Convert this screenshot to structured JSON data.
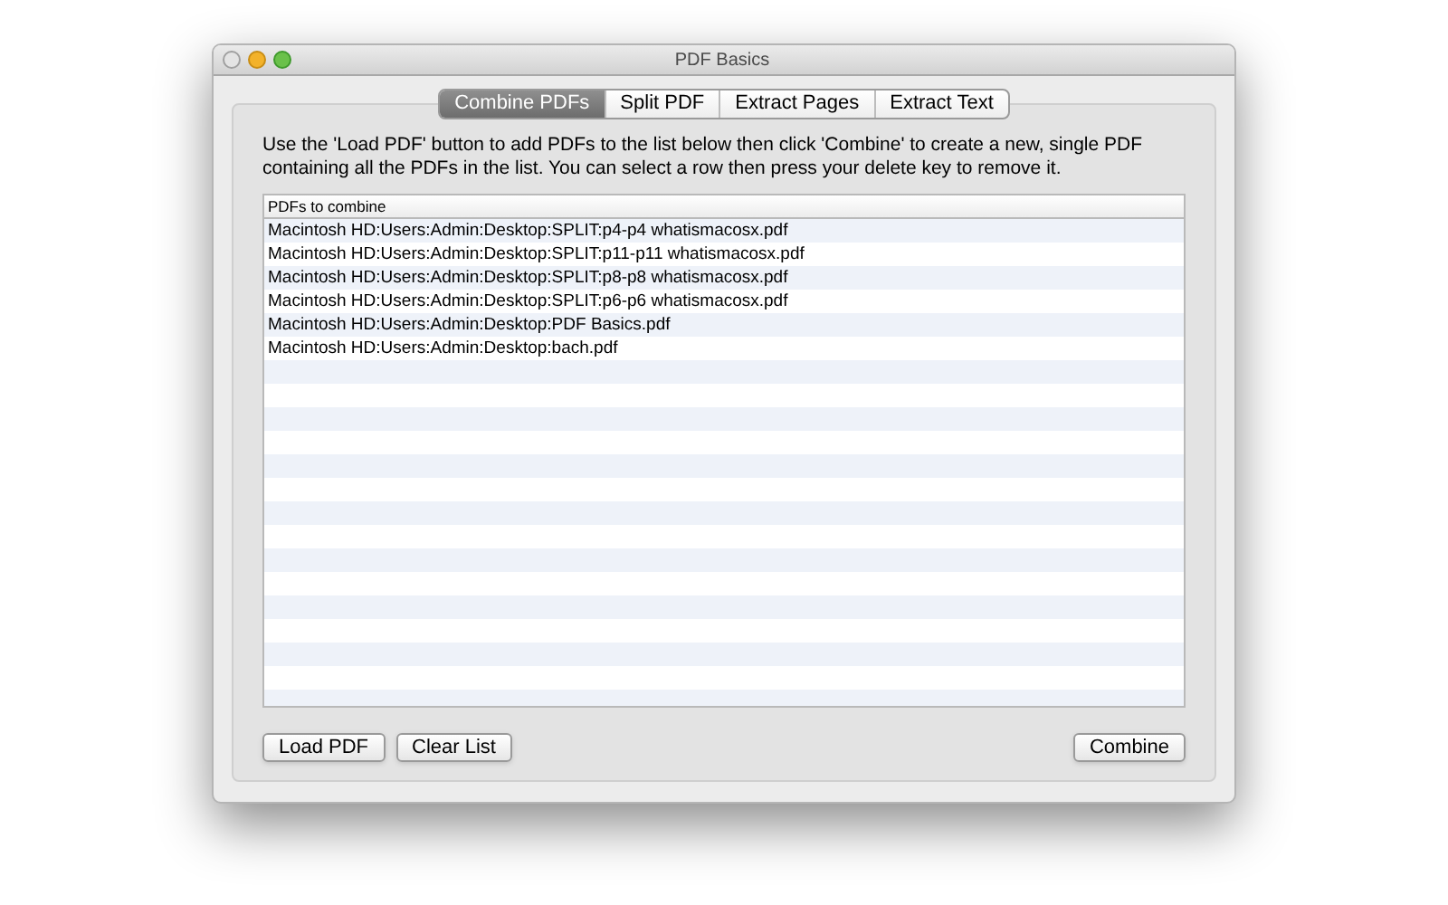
{
  "window": {
    "title": "PDF Basics"
  },
  "tabs": [
    {
      "label": "Combine PDFs",
      "selected": true
    },
    {
      "label": "Split PDF",
      "selected": false
    },
    {
      "label": "Extract Pages",
      "selected": false
    },
    {
      "label": "Extract Text",
      "selected": false
    }
  ],
  "instructions": "Use the 'Load PDF' button to add PDFs to the list below then click 'Combine' to create a new, single PDF containing all the PDFs in the list. You can select a row then press your delete key to remove it.",
  "table": {
    "columns": [
      "PDFs to combine"
    ],
    "rows": [
      "Macintosh HD:Users:Admin:Desktop:SPLIT:p4-p4 whatismacosx.pdf",
      "Macintosh HD:Users:Admin:Desktop:SPLIT:p11-p11 whatismacosx.pdf",
      "Macintosh HD:Users:Admin:Desktop:SPLIT:p8-p8 whatismacosx.pdf",
      "Macintosh HD:Users:Admin:Desktop:SPLIT:p6-p6 whatismacosx.pdf",
      "Macintosh HD:Users:Admin:Desktop:PDF Basics.pdf",
      "Macintosh HD:Users:Admin:Desktop:bach.pdf"
    ]
  },
  "buttons_left": [
    "Load PDF",
    "Clear List"
  ],
  "buttons_right": [
    "Combine"
  ]
}
